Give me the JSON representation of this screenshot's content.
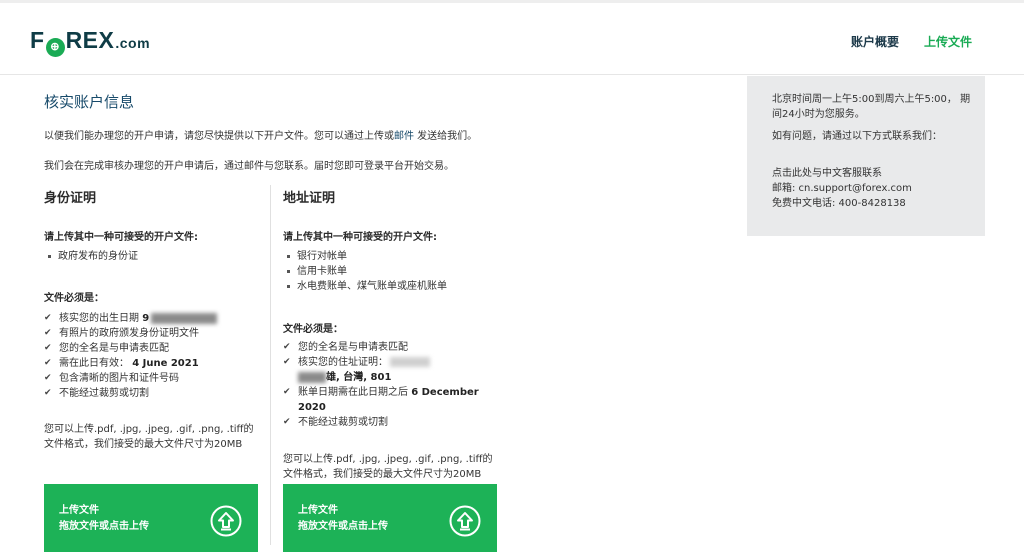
{
  "header": {
    "logo": {
      "part1": "F",
      "o": "⊕",
      "part2": "REX",
      "com": ".com"
    },
    "nav": [
      "账户概要",
      "上传文件"
    ]
  },
  "main": {
    "title": "核实账户信息",
    "para1": {
      "before": "以便我们能办理您的开户申请，请您尽快提供以下开户文件。您可以通过上传或",
      "link": "邮件",
      "after": " 发送给我们。"
    },
    "para2": "我们会在完成审核办理您的开户申请后，通过邮件与您联系。届时您即可登录平台开始交易。"
  },
  "identity": {
    "heading": "身份证明",
    "accept_heading": "请上传其中一种可接受的开户文件:",
    "accepted": [
      "政府发布的身份证"
    ],
    "must_heading": "文件必须是：",
    "requirements": [
      {
        "text": "核实您的出生日期 ",
        "bold": "9"
      },
      {
        "text": "有照片的政府颁发身份证明文件"
      },
      {
        "text": "您的全名是与申请表匹配"
      },
      {
        "text": "需在此日有效：  ",
        "bold": "4 June 2021"
      },
      {
        "text": "包含清晰的图片和证件号码"
      },
      {
        "text": "不能经过裁剪或切割"
      }
    ],
    "formats_note": "您可以上传.pdf, .jpg, .jpeg, .gif, .png, .tiff的文件格式，我们接受的最大文件尺寸为20MB",
    "upload": {
      "title": "上传文件",
      "subtitle": "拖放文件或点击上传"
    }
  },
  "address": {
    "heading": "地址证明",
    "accept_heading": "请上传其中一种可接受的开户文件:",
    "accepted": [
      "银行对帐单",
      "信用卡账单",
      "水电费账单、煤气账单或座机账单"
    ],
    "must_heading": "文件必须是：",
    "requirements": [
      {
        "text": "您的全名是与申请表匹配"
      },
      {
        "text": "核实您的住址证明：",
        "line2": "雄, 台灣, 801"
      },
      {
        "text": "账单日期需在此日期之后 ",
        "bold": "6 December",
        "line2": "2020"
      },
      {
        "text": "不能经过裁剪或切割"
      }
    ],
    "formats_note": "您可以上传.pdf, .jpg, .jpeg, .gif, .png, .tiff的文件格式，我们接受的最大文件尺寸为20MB",
    "upload": {
      "title": "上传文件",
      "subtitle": "拖放文件或点击上传"
    }
  },
  "sidebar": {
    "hours": "北京时间周一上午5:00到周六上午5:00， 期间24小时为您服务。",
    "ask": "如有问题，请通过以下方式联系我们：",
    "contact_link": "点击此处与中文客服联系",
    "email": "邮箱: cn.support@forex.com",
    "phone": "免费中文电话: 400-8428138"
  },
  "icons": {
    "check": "check-icon",
    "upload": "upload-arrow-icon"
  },
  "colors": {
    "brand_green": "#1db257",
    "nav_dark": "#1d3a4a",
    "title_blue": "#174a6a",
    "sidebar_bg": "#e9eaeb"
  }
}
